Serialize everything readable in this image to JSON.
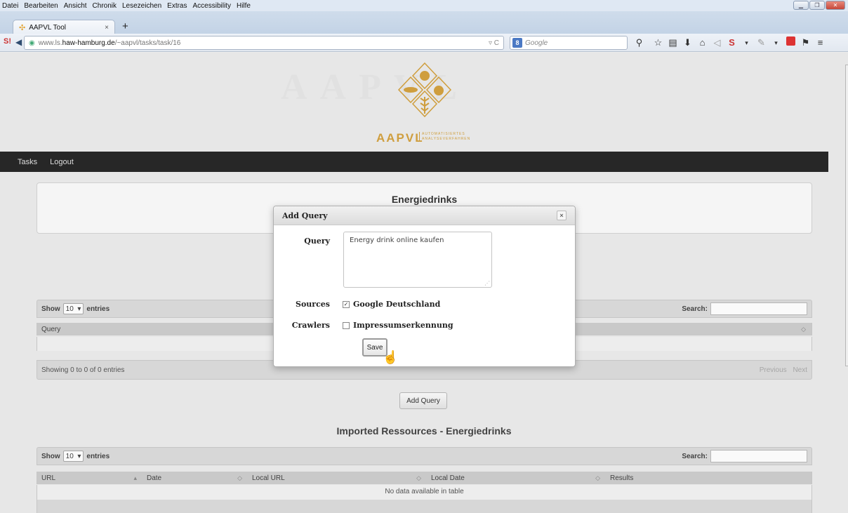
{
  "browser": {
    "menu": [
      "Datei",
      "Bearbeiten",
      "Ansicht",
      "Chronik",
      "Lesezeichen",
      "Extras",
      "Accessibility",
      "Hilfe"
    ],
    "tab_title": "AAPVL Tool",
    "tab_close": "×",
    "new_tab": "+",
    "url_prefix": "www.ls.",
    "url_host": "haw-hamburg.de",
    "url_path": "/~aapvl/tasks/task/16",
    "search_engine_letter": "8",
    "search_placeholder": "Google"
  },
  "app": {
    "logo_text": "AAPVL",
    "logo_sub_line1": "AUTOMATISIERTES",
    "logo_sub_line2": "ANALYSEVERFAHREN",
    "nav": [
      "Tasks",
      "Logout"
    ]
  },
  "task": {
    "title": "Energiedrinks"
  },
  "queries_table": {
    "show_label": "Show",
    "page_size": "10",
    "entries_label": "entries",
    "search_label": "Search:",
    "columns": [
      "Query"
    ],
    "info": "Showing 0 to 0 of 0 entries",
    "prev": "Previous",
    "next": "Next"
  },
  "add_query_button": "Add Query",
  "resources": {
    "title": "Imported Ressources - Energiedrinks",
    "show_label": "Show",
    "page_size": "10",
    "entries_label": "entries",
    "search_label": "Search:",
    "columns": [
      "URL",
      "Date",
      "Local URL",
      "Local Date",
      "Results"
    ],
    "empty": "No data available in table"
  },
  "modal": {
    "title": "Add Query",
    "close": "×",
    "query_label": "Query",
    "query_value": "Energy drink online kaufen",
    "sources_label": "Sources",
    "sources": [
      {
        "label": "Google Deutschland",
        "checked": true
      }
    ],
    "crawlers_label": "Crawlers",
    "crawlers": [
      {
        "label": "Impressumserkennung",
        "checked": false
      }
    ],
    "save_label": "Save"
  }
}
